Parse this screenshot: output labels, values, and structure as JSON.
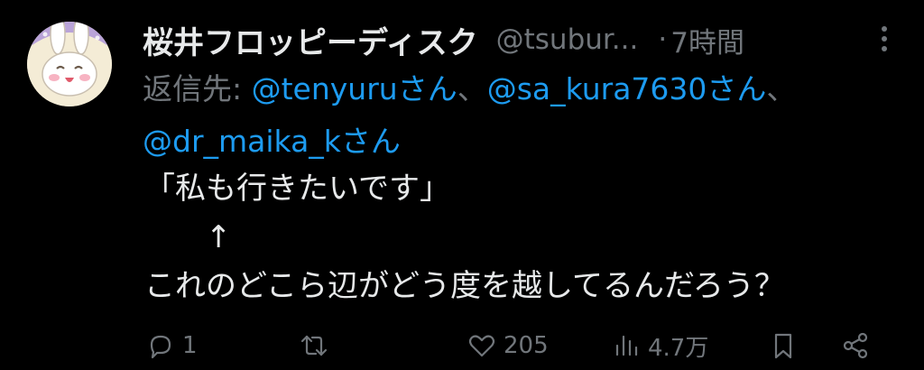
{
  "author": {
    "name": "桜井フロッピーディスク",
    "handle": "@tsubur...",
    "separator": "·",
    "time": "7時間"
  },
  "reply_to": {
    "prefix": "返信先: ",
    "mentions": [
      "@tenyuruさん",
      "@sa_kura7630さん",
      "@dr_maika_kさん"
    ],
    "joiner": "、"
  },
  "body": {
    "lines": [
      "「私も行きたいです」",
      "　　↑",
      "これのどこら辺がどう度を越してるんだろう？"
    ]
  },
  "actions": {
    "reply_count": "1",
    "retweet_count": "",
    "like_count": "205",
    "view_count": "4.7万"
  },
  "icons": [
    "avatar-bunny",
    "more-icon",
    "reply-icon",
    "retweet-icon",
    "like-icon",
    "views-icon",
    "bookmark-icon",
    "share-icon"
  ],
  "colors": {
    "background": "#000000",
    "text": "#e7e9ea",
    "muted": "#71767b",
    "link": "#1d9bf0"
  }
}
